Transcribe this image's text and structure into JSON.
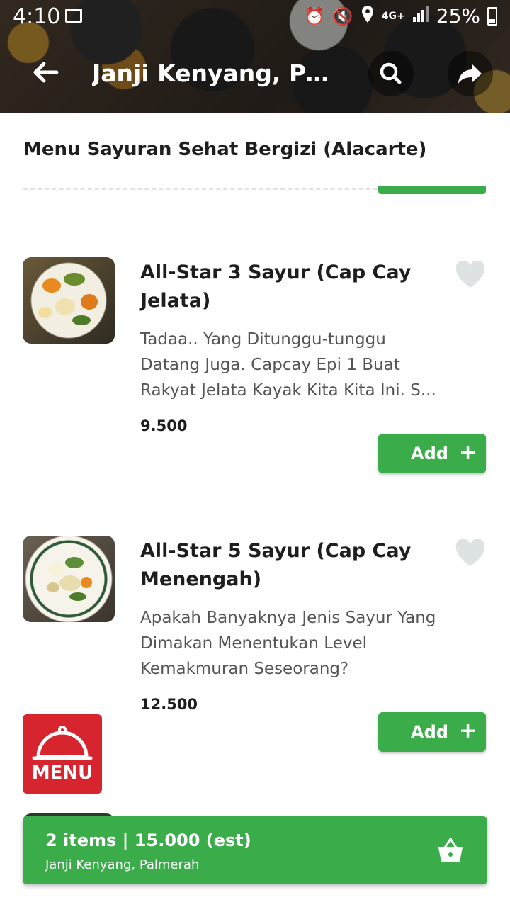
{
  "status_bar": {
    "time": "4:10",
    "network": "4G+",
    "battery": "25%"
  },
  "header": {
    "title": "Janji Kenyang, Pal..."
  },
  "section": {
    "title": "Menu Sayuran Sehat Bergizi (Alacarte)"
  },
  "items": [
    {
      "name": "All-Star 3 Sayur (Cap Cay Jelata)",
      "description": "Tadaa.. Yang Ditunggu-tunggu Datang Juga. Capcay Epi 1 Buat Rakyat Jelata Kayak Kita Kita Ini. S...",
      "price": "9.500",
      "add_label": "Add",
      "add_symbol": "+"
    },
    {
      "name": "All-Star 5 Sayur (Cap Cay Menengah)",
      "description": "Apakah Banyaknya Jenis Sayur Yang Dimakan Menentukan Level Kemakmuran Seseorang?",
      "price": "12.500",
      "add_label": "Add",
      "add_symbol": "+"
    }
  ],
  "menu_button": {
    "label": "MENU"
  },
  "cart": {
    "summary": "2 items | 15.000 (est)",
    "store": "Janji Kenyang, Palmerah"
  },
  "colors": {
    "accent": "#3aad4a",
    "menu_red": "#d6252f",
    "heart": "#dde3e2"
  }
}
